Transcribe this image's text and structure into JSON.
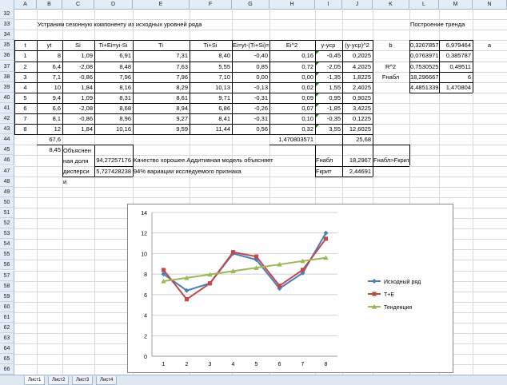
{
  "columns": [
    "A",
    "B",
    "C",
    "D",
    "E",
    "F",
    "G",
    "H",
    "I",
    "J",
    "K",
    "L",
    "M",
    "N"
  ],
  "rows": [
    "32",
    "33",
    "34",
    "35",
    "36",
    "37",
    "38",
    "39",
    "40",
    "41",
    "42",
    "43",
    "44",
    "45",
    "46",
    "47",
    "48",
    "49",
    "50",
    "51",
    "52",
    "53",
    "54",
    "55",
    "56",
    "57",
    "58",
    "59",
    "60",
    "61",
    "62",
    "63",
    "64",
    "65",
    "66"
  ],
  "title_left": "Устраним сезонную компоненту из исходных уровней ряда",
  "title_right": "Построение тренда",
  "headers": [
    "t",
    "yt",
    "Si",
    "Ti+Ei=yi-Si",
    "Ti",
    "Ti+Si",
    "Ei=yt-(Ti+Si)=",
    "Ei^2",
    "y-ycp",
    "(y-ycp)^2"
  ],
  "table": [
    [
      "1",
      "8",
      "1,09",
      "6,91",
      "7,31",
      "8,40",
      "-0,40",
      "0,16",
      "-0,45",
      "0,2025"
    ],
    [
      "2",
      "6,4",
      "-2,08",
      "8,48",
      "7,63",
      "5,55",
      "0,85",
      "0,72",
      "-2,05",
      "4,2025"
    ],
    [
      "3",
      "7,1",
      "-0,86",
      "7,96",
      "7,96",
      "7,10",
      "0,00",
      "0,00",
      "-1,35",
      "1,8225"
    ],
    [
      "4",
      "10",
      "1,84",
      "8,16",
      "8,29",
      "10,13",
      "-0,13",
      "0,02",
      "1,55",
      "2,4025"
    ],
    [
      "5",
      "9,4",
      "1,09",
      "8,31",
      "8,61",
      "9,71",
      "-0,31",
      "0,09",
      "0,95",
      "0,9025"
    ],
    [
      "6",
      "6,6",
      "-2,08",
      "8,68",
      "8,94",
      "6,86",
      "-0,26",
      "0,07",
      "-1,85",
      "3,4225"
    ],
    [
      "7",
      "8,1",
      "-0,86",
      "8,96",
      "9,27",
      "8,41",
      "-0,31",
      "0,10",
      "-0,35",
      "0,1225"
    ],
    [
      "8",
      "12",
      "1,84",
      "10,16",
      "9,59",
      "11,44",
      "0,56",
      "0,32",
      "3,55",
      "12,6025"
    ]
  ],
  "sum_yt": "67,6",
  "avg_yt": "8,45",
  "sum_ei2": "1,470803571",
  "sum_dev2": "25,68",
  "trend_label_b": "b",
  "trend_label_a": "a",
  "trend_label_r2": "R^2",
  "trend_label_fnabl": "Fнабл",
  "trend_values": [
    [
      "0,32678571",
      "6,979464"
    ],
    [
      "0,07639713",
      "0,385787"
    ],
    [
      "0,75305255",
      "0,49511"
    ],
    [
      "18,2966673",
      "6"
    ],
    [
      "4,48513393",
      "1,470804"
    ]
  ],
  "explained_label": [
    "Объяснен",
    "ная доля",
    "дисперси",
    "и"
  ],
  "explained_value": "94,27257176",
  "explained_value2": "5,727428238",
  "quality_text1": "Качество хорошее.Аддитивная модель объясняет",
  "quality_text2": "94% вариации исследуемого признака",
  "fnabl_label": "Fнабл",
  "fnabl_value": "18,2967",
  "fkrit_label": "Fкрит",
  "fkrit_value": "2,44691",
  "conclusion": "Fнабл>Fкрит",
  "sheet_tabs": [
    "Лист1",
    "Лист2",
    "Лист3",
    "Лист4"
  ],
  "chart_data": {
    "type": "line",
    "x": [
      1,
      2,
      3,
      4,
      5,
      6,
      7,
      8
    ],
    "ylim": [
      0,
      14
    ],
    "yticks": [
      0,
      2,
      4,
      6,
      8,
      10,
      12,
      14
    ],
    "series": [
      {
        "name": "Исходный ряд",
        "values": [
          8,
          6.4,
          7.1,
          10,
          9.4,
          6.6,
          8.1,
          12
        ],
        "color": "#4a7ebb",
        "marker": "diamond"
      },
      {
        "name": "T+E",
        "values": [
          8.4,
          5.55,
          7.1,
          10.13,
          9.71,
          6.86,
          8.41,
          11.44
        ],
        "color": "#be4b48",
        "marker": "square"
      },
      {
        "name": "Тенденция",
        "values": [
          7.31,
          7.63,
          7.96,
          8.29,
          8.61,
          8.94,
          9.27,
          9.59
        ],
        "color": "#98b954",
        "marker": "triangle"
      }
    ]
  }
}
